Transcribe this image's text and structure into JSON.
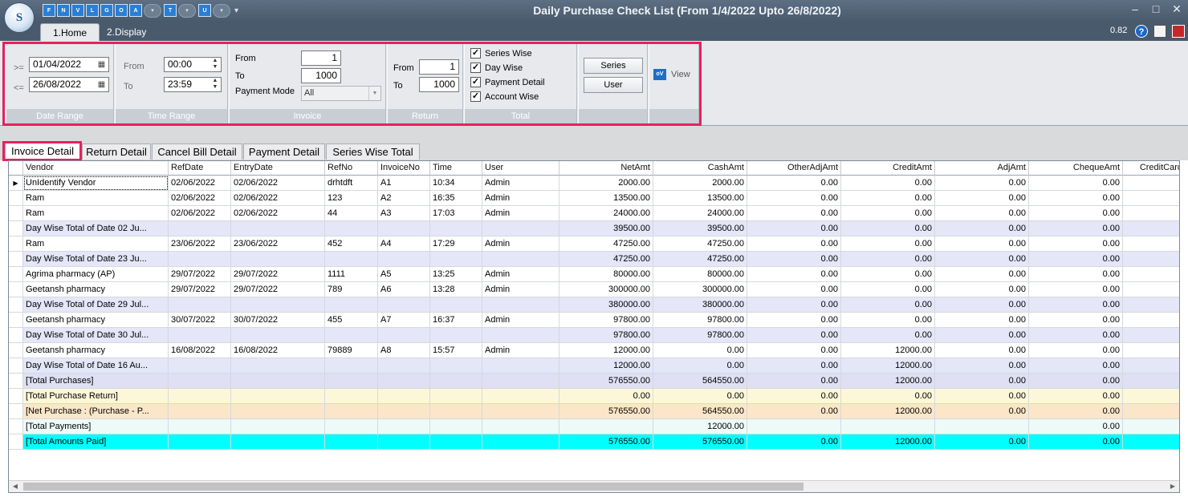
{
  "window": {
    "title": "Daily Purchase Check List (From 1/4/2022 Upto 26/8/2022)"
  },
  "qat": {
    "buttons": [
      "F",
      "N",
      "V",
      "L",
      "G",
      "O",
      "A",
      "T",
      "U"
    ]
  },
  "ribbon_tabs": [
    "1.Home",
    "2.Display"
  ],
  "version": "0.82",
  "date_range": {
    "ge_label": ">=",
    "le_label": "<=",
    "from": "01/04/2022",
    "to": "26/08/2022",
    "footer": "Date Range"
  },
  "time_range": {
    "from_label": "From",
    "to_label": "To",
    "from": "00:00",
    "to": "23:59",
    "footer": "Time Range"
  },
  "invoice": {
    "from_label": "From",
    "to_label": "To",
    "from": "1",
    "to": "1000",
    "payment_mode_label": "Payment Mode",
    "payment_mode": "All",
    "footer": "Invoice"
  },
  "return_grp": {
    "from_label": "From",
    "to_label": "To",
    "from": "1",
    "to": "1000",
    "footer": "Return"
  },
  "total": {
    "options": [
      {
        "label": "Series Wise",
        "checked": true
      },
      {
        "label": "Day Wise",
        "checked": true
      },
      {
        "label": "Payment Detail",
        "checked": true
      },
      {
        "label": "Account Wise",
        "checked": true
      }
    ],
    "footer": "Total"
  },
  "buttons": {
    "series": "Series",
    "user": "User",
    "view": "View"
  },
  "detail_tabs": [
    "Invoice Detail",
    "Return Detail",
    "Cancel Bill Detail",
    "Payment Detail",
    "Series Wise Total"
  ],
  "grid": {
    "columns": [
      "Vendor",
      "RefDate",
      "EntryDate",
      "RefNo",
      "InvoiceNo",
      "Time",
      "User",
      "NetAmt",
      "CashAmt",
      "OtherAdjAmt",
      "CreditAmt",
      "AdjAmt",
      "ChequeAmt",
      "CreditCard"
    ],
    "rows": [
      {
        "type": "data",
        "cells": [
          "UnIdentify Vendor",
          "02/06/2022",
          "02/06/2022",
          "drhtdft",
          "A1",
          "10:34",
          "Admin",
          "2000.00",
          "2000.00",
          "0.00",
          "0.00",
          "0.00",
          "0.00",
          ""
        ]
      },
      {
        "type": "data",
        "cells": [
          "Ram",
          "02/06/2022",
          "02/06/2022",
          "123",
          "A2",
          "16:35",
          "Admin",
          "13500.00",
          "13500.00",
          "0.00",
          "0.00",
          "0.00",
          "0.00",
          ""
        ]
      },
      {
        "type": "data",
        "cells": [
          "Ram",
          "02/06/2022",
          "02/06/2022",
          "44",
          "A3",
          "17:03",
          "Admin",
          "24000.00",
          "24000.00",
          "0.00",
          "0.00",
          "0.00",
          "0.00",
          ""
        ]
      },
      {
        "type": "day",
        "cells": [
          "Day Wise Total of Date 02 Ju...",
          "",
          "",
          "",
          "",
          "",
          "",
          "39500.00",
          "39500.00",
          "0.00",
          "0.00",
          "0.00",
          "0.00",
          ""
        ]
      },
      {
        "type": "data",
        "cells": [
          "Ram",
          "23/06/2022",
          "23/06/2022",
          "452",
          "A4",
          "17:29",
          "Admin",
          "47250.00",
          "47250.00",
          "0.00",
          "0.00",
          "0.00",
          "0.00",
          ""
        ]
      },
      {
        "type": "day",
        "cells": [
          "Day Wise Total of Date 23 Ju...",
          "",
          "",
          "",
          "",
          "",
          "",
          "47250.00",
          "47250.00",
          "0.00",
          "0.00",
          "0.00",
          "0.00",
          ""
        ]
      },
      {
        "type": "data",
        "cells": [
          "Agrima pharmacy (AP)",
          "29/07/2022",
          "29/07/2022",
          "1111",
          "A5",
          "13:25",
          "Admin",
          "80000.00",
          "80000.00",
          "0.00",
          "0.00",
          "0.00",
          "0.00",
          ""
        ]
      },
      {
        "type": "data",
        "cells": [
          "Geetansh pharmacy",
          "29/07/2022",
          "29/07/2022",
          "789",
          "A6",
          "13:28",
          "Admin",
          "300000.00",
          "300000.00",
          "0.00",
          "0.00",
          "0.00",
          "0.00",
          ""
        ]
      },
      {
        "type": "day",
        "cells": [
          "Day Wise Total of Date 29 Jul...",
          "",
          "",
          "",
          "",
          "",
          "",
          "380000.00",
          "380000.00",
          "0.00",
          "0.00",
          "0.00",
          "0.00",
          ""
        ]
      },
      {
        "type": "data",
        "cells": [
          "Geetansh pharmacy",
          "30/07/2022",
          "30/07/2022",
          "455",
          "A7",
          "16:37",
          "Admin",
          "97800.00",
          "97800.00",
          "0.00",
          "0.00",
          "0.00",
          "0.00",
          ""
        ]
      },
      {
        "type": "day",
        "cells": [
          "Day Wise Total of Date 30 Jul...",
          "",
          "",
          "",
          "",
          "",
          "",
          "97800.00",
          "97800.00",
          "0.00",
          "0.00",
          "0.00",
          "0.00",
          ""
        ]
      },
      {
        "type": "data",
        "cells": [
          "Geetansh pharmacy",
          "16/08/2022",
          "16/08/2022",
          "79889",
          "A8",
          "15:57",
          "Admin",
          "12000.00",
          "0.00",
          "0.00",
          "12000.00",
          "0.00",
          "0.00",
          ""
        ]
      },
      {
        "type": "day",
        "cells": [
          "Day Wise Total of Date 16 Au...",
          "",
          "",
          "",
          "",
          "",
          "",
          "12000.00",
          "0.00",
          "0.00",
          "12000.00",
          "0.00",
          "0.00",
          ""
        ]
      },
      {
        "type": "total",
        "cells": [
          "[Total Purchases]",
          "",
          "",
          "",
          "",
          "",
          "",
          "576550.00",
          "564550.00",
          "0.00",
          "12000.00",
          "0.00",
          "0.00",
          ""
        ]
      },
      {
        "type": "ret",
        "cells": [
          "[Total Purchase Return]",
          "",
          "",
          "",
          "",
          "",
          "",
          "0.00",
          "0.00",
          "0.00",
          "0.00",
          "0.00",
          "0.00",
          ""
        ]
      },
      {
        "type": "net",
        "cells": [
          "[Net Purchase : (Purchase - P...",
          "",
          "",
          "",
          "",
          "",
          "",
          "576550.00",
          "564550.00",
          "0.00",
          "12000.00",
          "0.00",
          "0.00",
          ""
        ]
      },
      {
        "type": "pay",
        "cells": [
          "[Total Payments]",
          "",
          "",
          "",
          "",
          "",
          "",
          "",
          "12000.00",
          "",
          "",
          "",
          "0.00",
          ""
        ]
      },
      {
        "type": "paid",
        "cells": [
          "[Total Amounts Paid]",
          "",
          "",
          "",
          "",
          "",
          "",
          "576550.00",
          "576550.00",
          "0.00",
          "12000.00",
          "0.00",
          "0.00",
          ""
        ]
      }
    ]
  },
  "colors": {
    "highlight": "#e8215d",
    "day": "#e5e6f8",
    "total": "#dfe0f3",
    "ret": "#fdf7d9",
    "net": "#fbe6c9",
    "pay": "#eefaf8",
    "paid": "#00ffff"
  }
}
